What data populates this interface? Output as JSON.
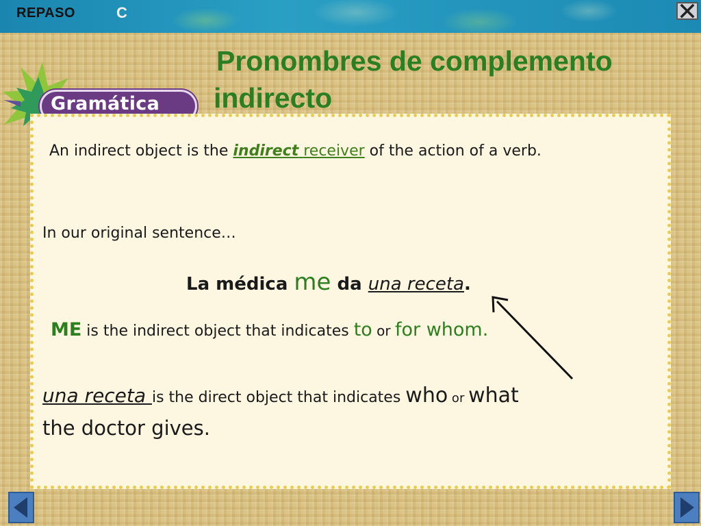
{
  "header": {
    "section_label": "REPASO",
    "section_letter": "C",
    "close_icon": "close-x-icon"
  },
  "title": {
    "line1": "Pronombres de complemento",
    "line2": "indirecto"
  },
  "badge": {
    "label": "Gramática",
    "icon": "star-burst-icon"
  },
  "content": {
    "line1": {
      "pre": "An indirect object is the ",
      "em": "indirect",
      "space": " ",
      "u": "receiver",
      "post": " of the action of a verb."
    },
    "line2": "In our original sentence…",
    "sentence": {
      "a": "La médica ",
      "me": "me",
      "b": " da ",
      "ur": "una receta",
      "c": "."
    },
    "me_line": {
      "me": "ME",
      "t1": " is the indirect object that indicates ",
      "to": "to",
      "or": " or ",
      "for_whom": "for whom",
      "end": "."
    },
    "do_line": {
      "ur": "una receta ",
      "t1": "is the direct object that indicates ",
      "who": "who",
      "or": " or ",
      "what": "what"
    },
    "do_line2": "the doctor gives."
  },
  "nav": {
    "prev_icon": "triangle-left-icon",
    "next_icon": "triangle-right-icon"
  },
  "colors": {
    "title": "#2a7f22",
    "accent_green": "#2c7f1e",
    "badge": "#6a3a82",
    "panel_border": "#e8cc55",
    "topbar": "#1d8fb8"
  }
}
